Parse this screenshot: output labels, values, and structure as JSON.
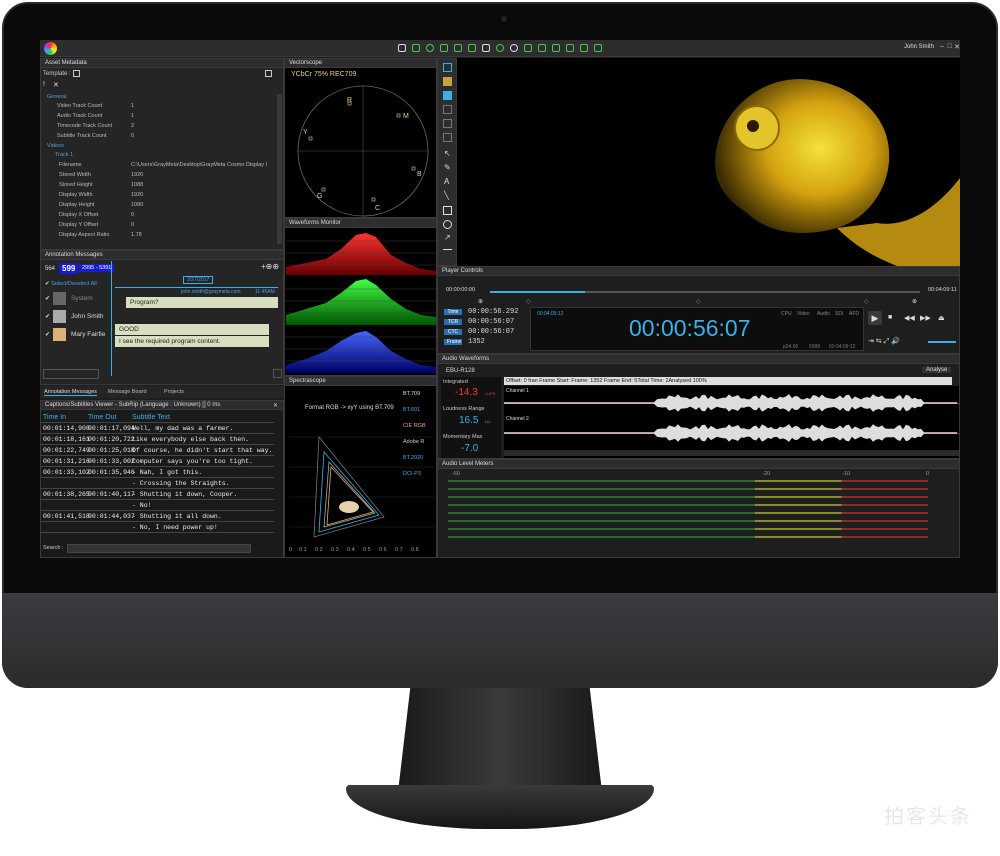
{
  "app": {
    "user": "John Smith",
    "window_buttons": [
      "–",
      "□",
      "✕"
    ]
  },
  "toolbar": {
    "icons": [
      "folder-icon",
      "film-icon",
      "circle-icon",
      "waveform-icon",
      "scope-icon",
      "levels-icon",
      "audio-icon",
      "target-icon",
      "clock-icon",
      "grid-icon",
      "list-icon",
      "table-icon",
      "speech-icon",
      "box-icon",
      "pen-icon"
    ]
  },
  "asset_metadata": {
    "title": "Asset Metadata",
    "template_label": "Template :",
    "sections": {
      "general": "General",
      "videos": "Videos",
      "track": "Track 1"
    },
    "general_rows": [
      {
        "k": "Video Track Count",
        "v": "1"
      },
      {
        "k": "Audio Track Count",
        "v": "1"
      },
      {
        "k": "Timecode Track Count",
        "v": "2"
      },
      {
        "k": "Subtitle Track Count",
        "v": "0"
      }
    ],
    "track_rows": [
      {
        "k": "Filename",
        "v": "C:\\Users\\GrayMeta\\Desktop\\GrayMeta Cosmo Display I"
      },
      {
        "k": "Stored Width",
        "v": "1920"
      },
      {
        "k": "Stored Height",
        "v": "1088"
      },
      {
        "k": "Display Width",
        "v": "1920"
      },
      {
        "k": "Display Height",
        "v": "1080"
      },
      {
        "k": "Display X Offset",
        "v": "0"
      },
      {
        "k": "Display Y Offset",
        "v": "0"
      },
      {
        "k": "Display Aspect Ratio",
        "v": "1.78"
      }
    ]
  },
  "annotations": {
    "title": "Annotation Messages",
    "count_left": "564",
    "count_main": "599",
    "count_range": "2995 - 5391",
    "select_all": "Select/Deselect All",
    "users": [
      "System",
      "John Smith",
      "Mary Fairfie"
    ],
    "date": "2/27/2017",
    "email": "john.smith@graymeta.com",
    "time": "11:45AM",
    "message1": "Program?",
    "message2": "GOOD",
    "message3": "I see the required program content.",
    "tabs": [
      "Annotation Messages",
      "Message Board",
      "Projects"
    ]
  },
  "captions": {
    "title": "Captions/Subtitles Viewer - SubRip (Language : Unknown) [] 0 ms",
    "headers": [
      "Time In",
      "Time Out",
      "Subtitle Text"
    ],
    "rows": [
      {
        "in": "00:01:14,908",
        "out": "00:01:17,094",
        "text": "Well, my dad was a farmer."
      },
      {
        "in": "00:01:18,161",
        "out": "00:01:20,722",
        "text": "Like everybody else back then."
      },
      {
        "in": "00:01:22,749",
        "out": "00:01:25,018",
        "text": "Of course, he didn't start that way."
      },
      {
        "in": "00:01:31,216",
        "out": "00:01:33,002",
        "text": "Computer says you're too tight."
      },
      {
        "in": "00:01:33,102",
        "out": "00:01:35,946",
        "text": "- Nah, I got this."
      },
      {
        "in": "",
        "out": "",
        "text": "- Crossing the Straights."
      },
      {
        "in": "00:01:38,265",
        "out": "00:01:40,117",
        "text": "- Shutting it down, Cooper."
      },
      {
        "in": "",
        "out": "",
        "text": "- No!"
      },
      {
        "in": "00:01:41,518",
        "out": "00:01:44,037",
        "text": "- Shutting it all down."
      },
      {
        "in": "",
        "out": "",
        "text": "- No, I need power up!"
      }
    ],
    "search_label": "Search :"
  },
  "vectorscope": {
    "title": "Vectorscope",
    "label": "YCbCr 75% REC709",
    "targets": [
      "R",
      "M",
      "B",
      "C",
      "G",
      "Y"
    ]
  },
  "waveforms": {
    "title": "Waveforms Monitor"
  },
  "spectrascope": {
    "title": "Spectrascope",
    "format": "Format RGB -> xyY using BT.709",
    "legend": [
      "BT.709",
      "BT.601",
      "CIE RGB",
      "Adobe R",
      "BT.2020",
      "DCI-P3"
    ],
    "xticks": [
      "0",
      "0.1",
      "0.2",
      "0.3",
      "0.4",
      "0.5",
      "0.6",
      "0.7",
      "0.8"
    ]
  },
  "player": {
    "title": "Player Controls",
    "start": "00:00:00:00",
    "end": "00:04:09:11",
    "mini_tc": "00:04:09:12",
    "progress": 0.22,
    "fields": [
      {
        "label": "Time",
        "value": "00:00:56.292"
      },
      {
        "label": "TCR",
        "value": "00:00:56:07"
      },
      {
        "label": "CTC",
        "value": "00:00:56:07"
      },
      {
        "label": "Frame",
        "value": "1352"
      }
    ],
    "big_tc": "00:00:56:07",
    "indicators": [
      "CPU",
      "Video",
      "Audio",
      "SDI",
      "AFD"
    ],
    "fps": "p24.00",
    "frames_total": "5988",
    "end_tc2": "00:04:09:12"
  },
  "audio_waveforms": {
    "title": "Audio Waveforms",
    "standard": "EBU-R128",
    "analyse": "Analyse",
    "integrated_label": "Integrated",
    "integrated_value": "-14.3",
    "integrated_unit": "LUFS",
    "range_label": "Loudness Range",
    "range_value": "16.5",
    "range_unit": "LU",
    "momentary_label": "Momentary Max",
    "momentary_value": "-7.0",
    "info": "Offset: 0 fran Frame Start:  Frame: 1352  Frame End: 5Total Time: 2Analysed 100%",
    "channels": [
      "Channel 1",
      "Channel 2"
    ]
  },
  "level_meters": {
    "title": "Audio Level Meters",
    "scale": [
      "-60",
      "-20",
      "-10",
      "0"
    ]
  }
}
